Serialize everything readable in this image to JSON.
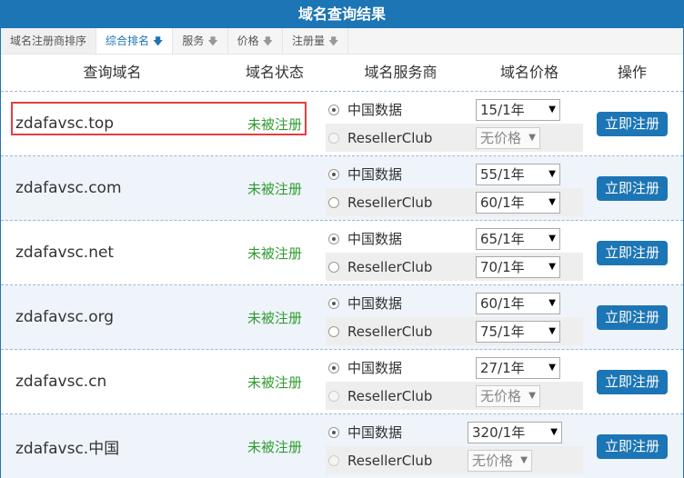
{
  "title": "域名查询结果",
  "tabs": [
    {
      "label": "域名注册商排序",
      "arrow": ""
    },
    {
      "label": "综合排名",
      "arrow": "🡇"
    },
    {
      "label": "服务",
      "arrow": "🡇"
    },
    {
      "label": "价格",
      "arrow": "🡇"
    },
    {
      "label": "注册量",
      "arrow": "🡇"
    }
  ],
  "headers": {
    "domain": "查询域名",
    "status": "域名状态",
    "vendor": "域名服务商",
    "price": "域名价格",
    "action": "操作"
  },
  "vendors": {
    "primary": "中国数据",
    "secondary": "ResellerClub"
  },
  "button_label": "立即注册",
  "dropdown_arrow": "▼",
  "rows": [
    {
      "domain": "zdafavsc.top",
      "status": "未被注册",
      "price1": "15/1年",
      "price2": "无价格",
      "secondary_available": false
    },
    {
      "domain": "zdafavsc.com",
      "status": "未被注册",
      "price1": "55/1年",
      "price2": "60/1年",
      "secondary_available": true
    },
    {
      "domain": "zdafavsc.net",
      "status": "未被注册",
      "price1": "65/1年",
      "price2": "70/1年",
      "secondary_available": true
    },
    {
      "domain": "zdafavsc.org",
      "status": "未被注册",
      "price1": "60/1年",
      "price2": "75/1年",
      "secondary_available": true
    },
    {
      "domain": "zdafavsc.cn",
      "status": "未被注册",
      "price1": "27/1年",
      "price2": "无价格",
      "secondary_available": false
    },
    {
      "domain": "zdafavsc.中国",
      "status": "未被注册",
      "price1": "320/1年",
      "price2": "无价格",
      "secondary_available": false
    }
  ],
  "colors": {
    "header_blue": "#1c75b5",
    "status_green": "#2f9b2f",
    "highlight_red": "#e04040"
  }
}
